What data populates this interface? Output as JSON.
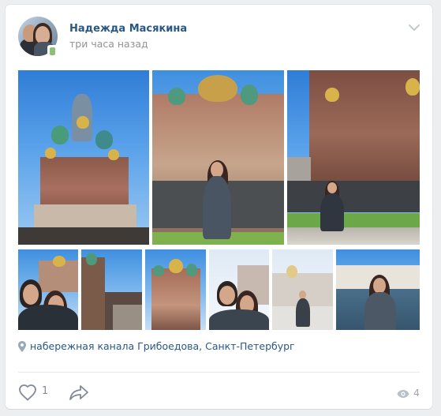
{
  "post": {
    "author": "Надежда Масякина",
    "time": "три часа назад",
    "location": "набережная канала Грибоедова, Санкт-Петербург",
    "likes": "1",
    "views": "4"
  },
  "icons": {
    "menu": "chevron-down-icon",
    "location": "map-pin-icon",
    "like": "heart-icon",
    "share": "share-arrow-icon",
    "views": "eye-icon"
  },
  "colors": {
    "link": "#2a5885",
    "muted": "#939393",
    "online": "#8ac176",
    "action": "#828a99"
  }
}
